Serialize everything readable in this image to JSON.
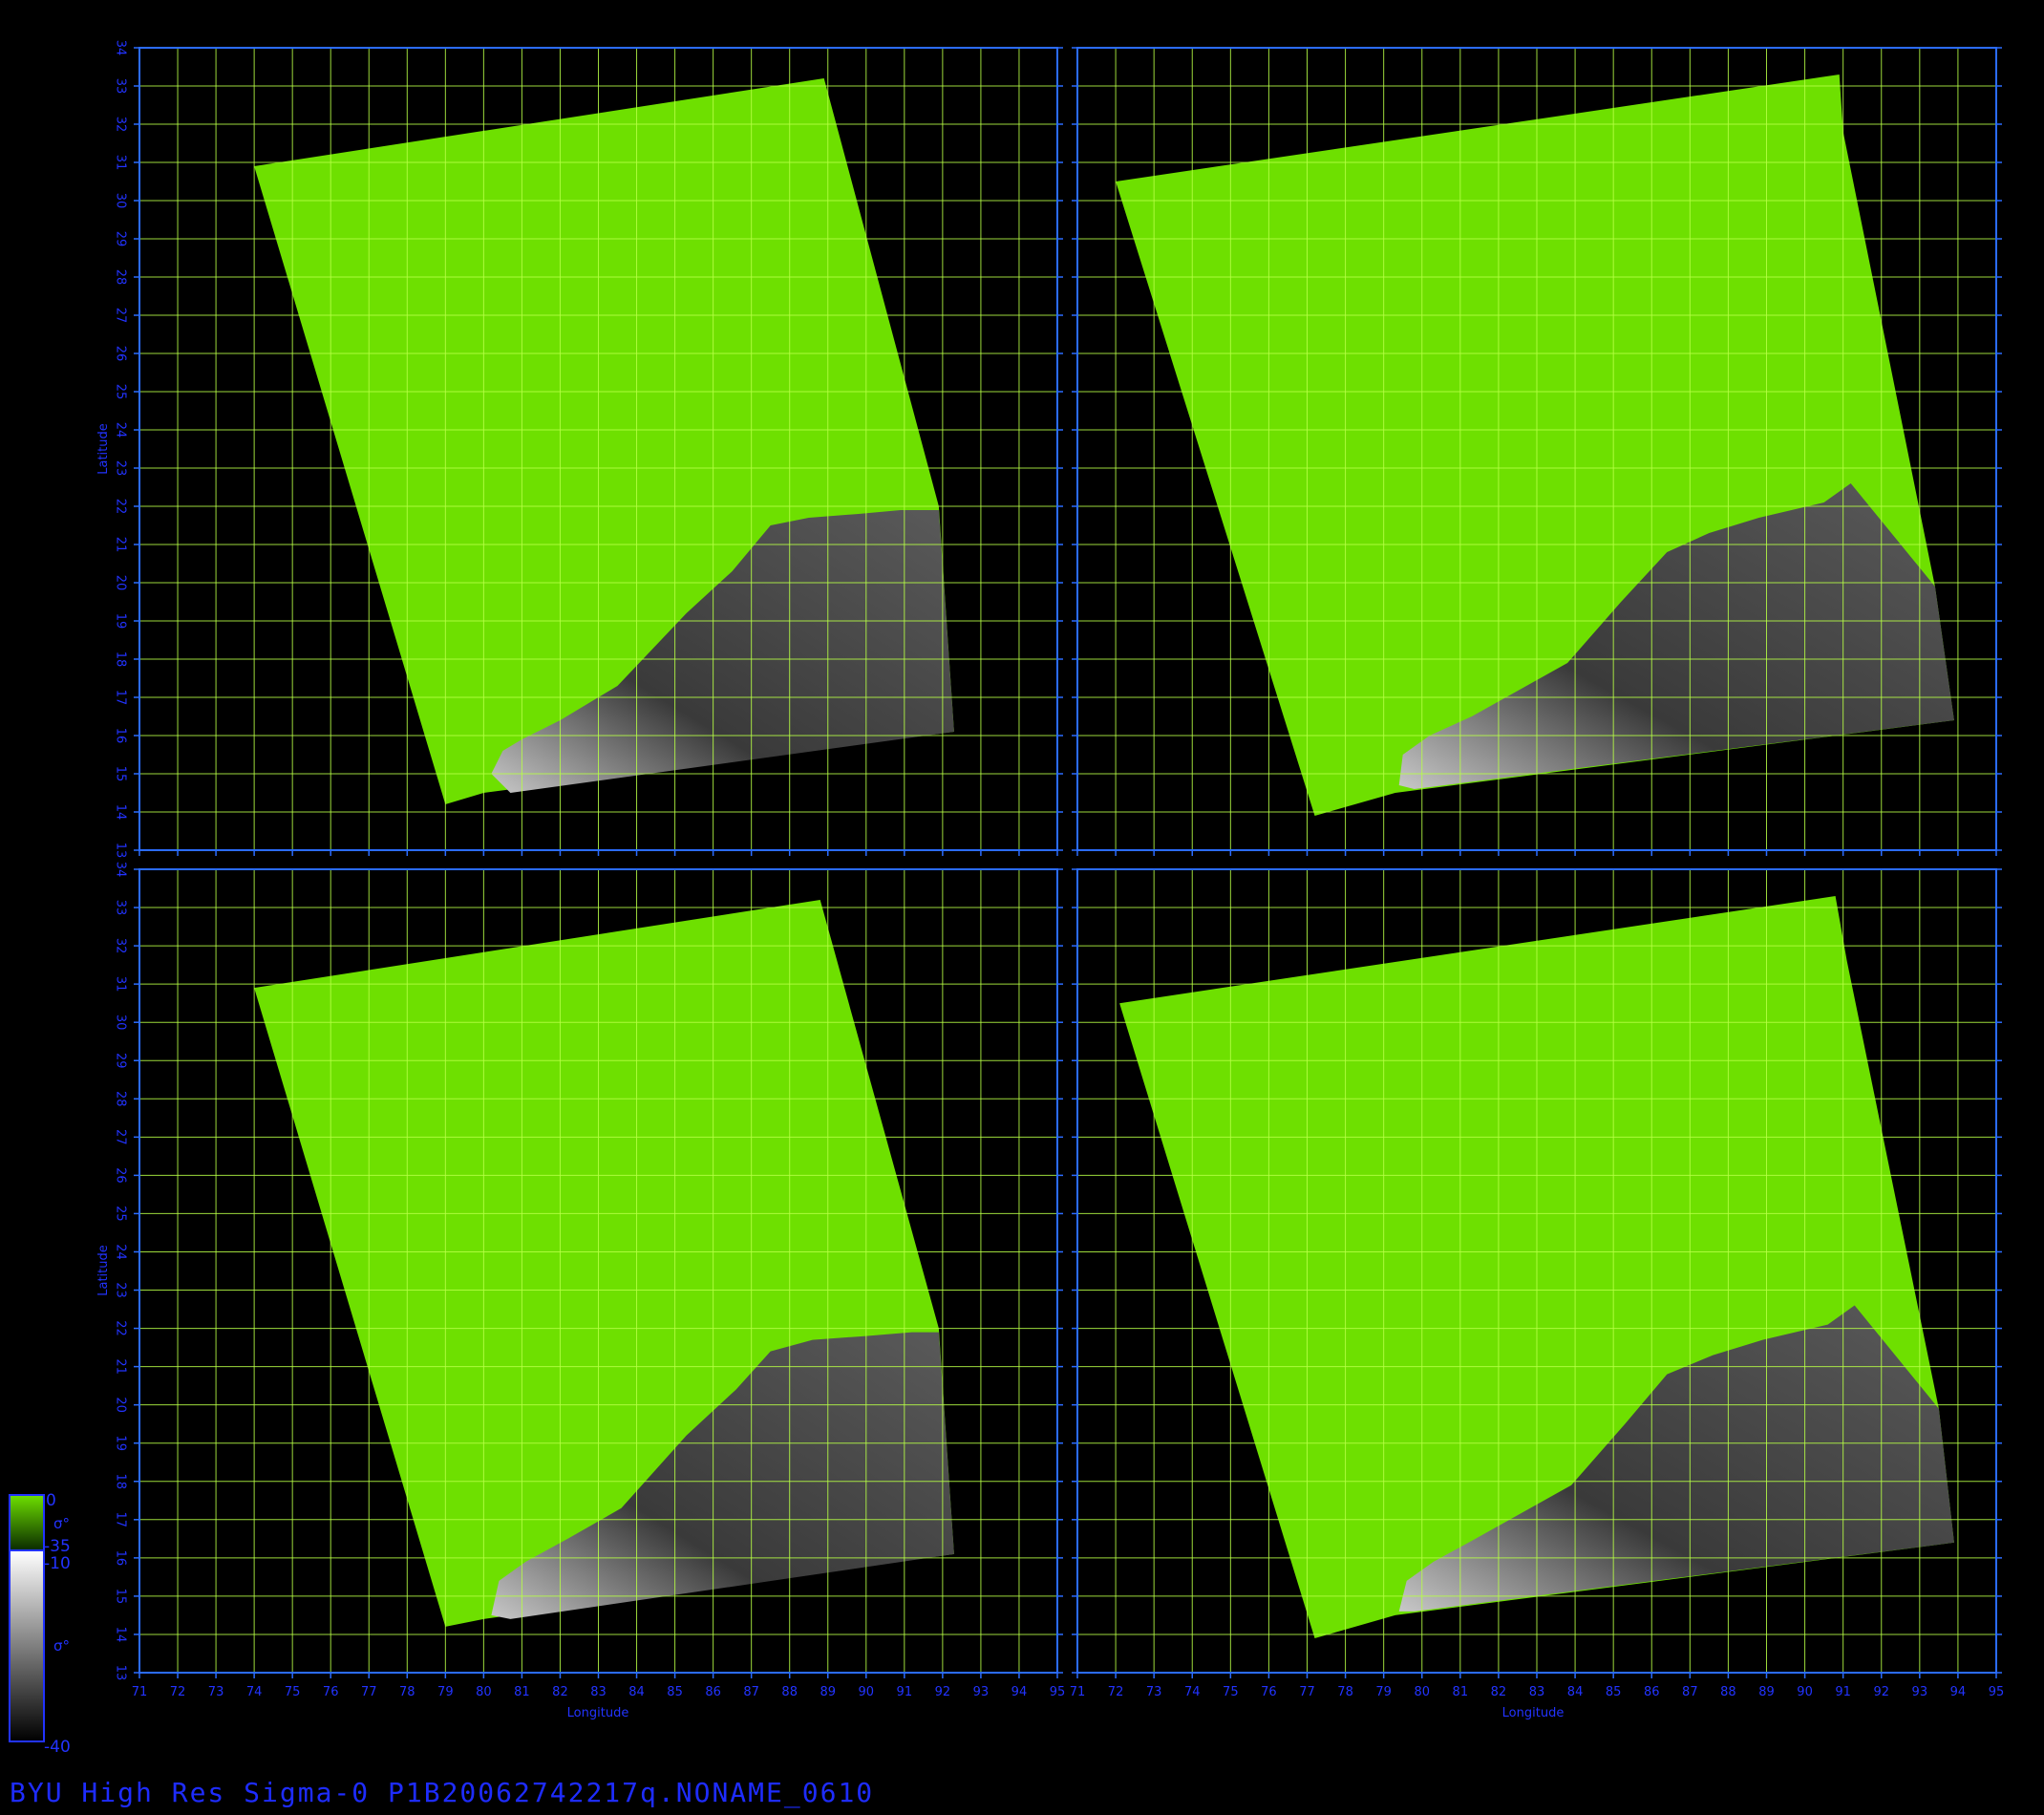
{
  "colors": {
    "background": "#000000",
    "frame": "#2b6cff",
    "axis_text": "#2233ff",
    "grid": "#b7ff45",
    "swath": "#6ee000",
    "land_light": "#c8c8c8",
    "land_dark": "#3a3a3a"
  },
  "axes": {
    "xlabel": "Longitude",
    "ylabel": "Latitude",
    "xlim": [
      71,
      95
    ],
    "ylim": [
      13,
      34
    ],
    "x_ticks": [
      "71",
      "72",
      "73",
      "74",
      "75",
      "76",
      "77",
      "78",
      "79",
      "80",
      "81",
      "82",
      "83",
      "84",
      "85",
      "86",
      "87",
      "88",
      "89",
      "90",
      "91",
      "92",
      "93",
      "94",
      "95"
    ],
    "y_ticks": [
      "13",
      "14",
      "15",
      "16",
      "17",
      "18",
      "19",
      "20",
      "21",
      "22",
      "23",
      "24",
      "25",
      "26",
      "27",
      "28",
      "29",
      "30",
      "31",
      "32",
      "33",
      "34"
    ]
  },
  "panels": [
    {
      "swath": [
        [
          74.0,
          30.9
        ],
        [
          88.9,
          33.2
        ],
        [
          91.9,
          22.0
        ],
        [
          92.3,
          16.1
        ],
        [
          80.0,
          14.5
        ],
        [
          79.0,
          14.2
        ]
      ],
      "land": [
        [
          80.2,
          15.0
        ],
        [
          80.5,
          15.6
        ],
        [
          81.0,
          15.9
        ],
        [
          82.0,
          16.4
        ],
        [
          83.5,
          17.3
        ],
        [
          85.3,
          19.2
        ],
        [
          86.5,
          20.3
        ],
        [
          87.5,
          21.5
        ],
        [
          88.5,
          21.7
        ],
        [
          89.8,
          21.8
        ],
        [
          90.9,
          21.9
        ],
        [
          91.9,
          21.9
        ],
        [
          92.3,
          16.1
        ],
        [
          80.7,
          14.5
        ]
      ]
    },
    {
      "swath": [
        [
          72.0,
          30.5
        ],
        [
          90.9,
          33.3
        ],
        [
          91.0,
          31.8
        ],
        [
          93.4,
          19.9
        ],
        [
          93.9,
          16.4
        ],
        [
          79.3,
          14.5
        ],
        [
          77.2,
          13.9
        ]
      ],
      "land": [
        [
          79.4,
          14.7
        ],
        [
          79.5,
          15.5
        ],
        [
          80.2,
          16.0
        ],
        [
          81.3,
          16.5
        ],
        [
          83.8,
          17.9
        ],
        [
          85.2,
          19.5
        ],
        [
          86.4,
          20.8
        ],
        [
          87.5,
          21.3
        ],
        [
          88.8,
          21.7
        ],
        [
          90.5,
          22.1
        ],
        [
          91.2,
          22.6
        ],
        [
          93.4,
          19.9
        ],
        [
          93.9,
          16.4
        ],
        [
          79.8,
          14.6
        ]
      ]
    },
    {
      "swath": [
        [
          74.0,
          30.9
        ],
        [
          88.8,
          33.2
        ],
        [
          91.9,
          22.0
        ],
        [
          92.3,
          16.1
        ],
        [
          80.0,
          14.4
        ],
        [
          79.0,
          14.2
        ]
      ],
      "land": [
        [
          80.2,
          14.5
        ],
        [
          80.4,
          15.4
        ],
        [
          81.1,
          15.9
        ],
        [
          82.2,
          16.5
        ],
        [
          83.6,
          17.3
        ],
        [
          85.3,
          19.2
        ],
        [
          86.6,
          20.4
        ],
        [
          87.5,
          21.4
        ],
        [
          88.6,
          21.7
        ],
        [
          90.0,
          21.8
        ],
        [
          91.2,
          21.9
        ],
        [
          91.9,
          21.9
        ],
        [
          92.3,
          16.1
        ],
        [
          80.7,
          14.4
        ]
      ]
    },
    {
      "swath": [
        [
          72.1,
          30.5
        ],
        [
          90.8,
          33.3
        ],
        [
          91.1,
          31.6
        ],
        [
          93.5,
          19.9
        ],
        [
          93.9,
          16.4
        ],
        [
          79.3,
          14.5
        ],
        [
          77.2,
          13.9
        ]
      ],
      "land": [
        [
          79.4,
          14.6
        ],
        [
          79.6,
          15.4
        ],
        [
          80.3,
          15.9
        ],
        [
          81.4,
          16.5
        ],
        [
          83.9,
          17.9
        ],
        [
          85.3,
          19.5
        ],
        [
          86.4,
          20.8
        ],
        [
          87.6,
          21.3
        ],
        [
          88.9,
          21.7
        ],
        [
          90.6,
          22.1
        ],
        [
          91.3,
          22.6
        ],
        [
          93.5,
          19.9
        ],
        [
          93.9,
          16.4
        ],
        [
          79.8,
          14.6
        ]
      ]
    }
  ],
  "legend": {
    "sea_top": "0",
    "sea_symbol": "σ°",
    "sea_bottom": "-35",
    "land_top": "-10",
    "land_symbol": "σ°",
    "land_bottom": "-40"
  },
  "footer_title": "BYU High Res Sigma-0 P1B20062742217q.NONAME_0610"
}
